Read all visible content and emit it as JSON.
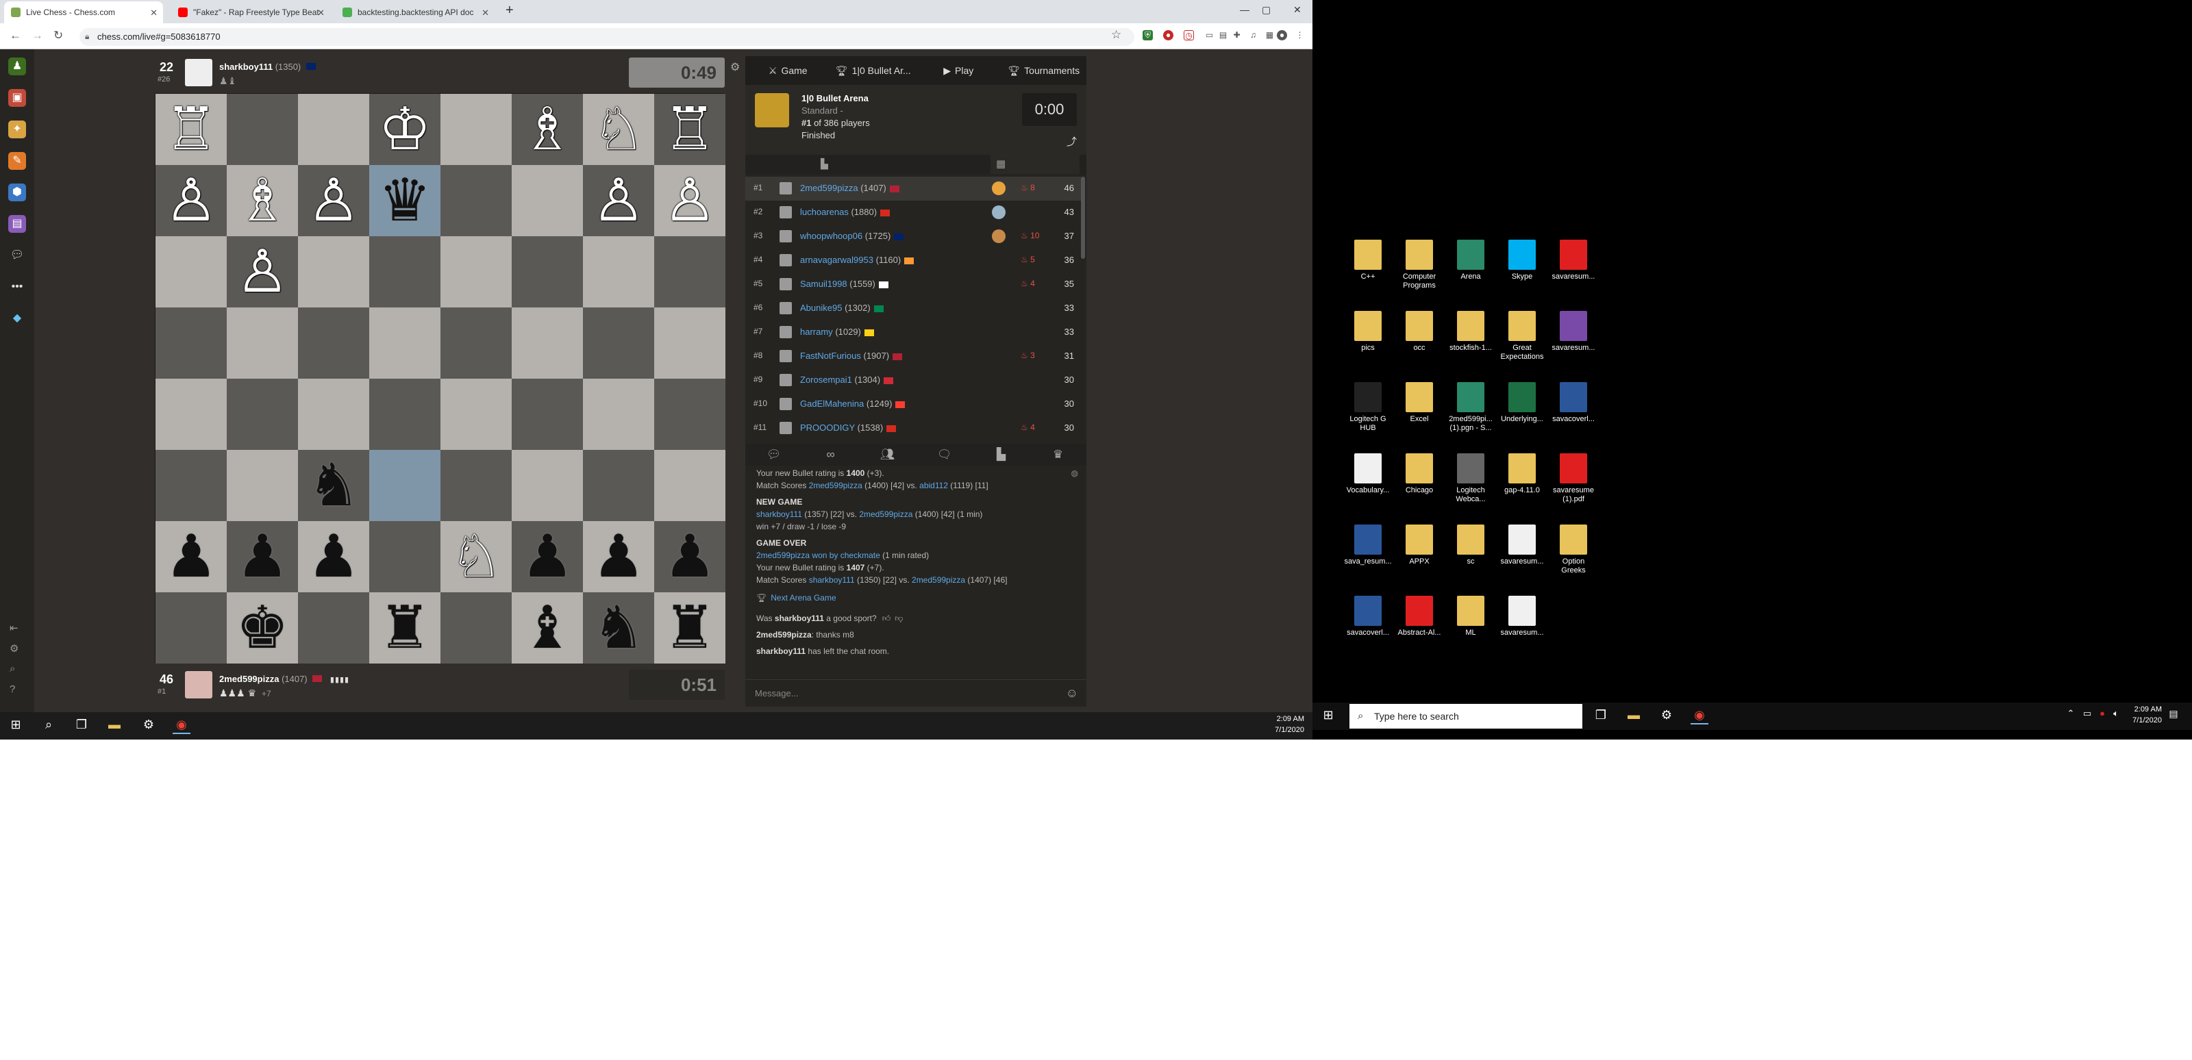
{
  "browser": {
    "tabs": [
      {
        "title": "Live Chess - Chess.com",
        "active": true,
        "fav_color": "#7fa650"
      },
      {
        "title": "\"Fakez\" - Rap Freestyle Type Beat",
        "active": false,
        "fav_color": "#ff0000"
      },
      {
        "title": "backtesting.backtesting API doc",
        "active": false,
        "fav_color": "#4caf50"
      }
    ],
    "new_tab": "+",
    "window_controls": {
      "minimize": "—",
      "maximize": "▢",
      "close": "✕"
    },
    "url": "chess.com/live#g=5083618770"
  },
  "top_player": {
    "score": "22",
    "rank": "#26",
    "name": "sharkboy111",
    "rating": "(1350)",
    "clock": "0:49",
    "captured": "♟♝"
  },
  "bottom_player": {
    "score": "46",
    "rank": "#1",
    "name": "2med599pizza",
    "rating": "(1407)",
    "clock": "0:51",
    "captured": "♟♟♟ ♛",
    "material": "+7"
  },
  "board": [
    [
      "♖",
      "",
      "",
      "♔",
      "",
      "♗",
      "♘",
      "♖"
    ],
    [
      "♙",
      "♗",
      "♙",
      "♛",
      "",
      "",
      "♙",
      "♙"
    ],
    [
      "",
      "♙",
      "",
      "",
      "",
      "",
      "",
      ""
    ],
    [
      "",
      "",
      "",
      "",
      "",
      "",
      "",
      ""
    ],
    [
      "",
      "",
      "",
      "",
      "",
      "",
      "",
      ""
    ],
    [
      "",
      "",
      "♞",
      "",
      "",
      "",
      "",
      ""
    ],
    [
      "♟",
      "♟",
      "♟",
      "",
      "♘",
      "♟",
      "♟",
      "♟"
    ],
    [
      "",
      "♚",
      "",
      "♜",
      "",
      "♝",
      "♞",
      "♜"
    ]
  ],
  "board_colors": {
    "white_pieces": [
      "♔",
      "♕",
      "♖",
      "♗",
      "♘",
      "♙"
    ],
    "highlight": [
      [
        1,
        3
      ],
      [
        5,
        3
      ]
    ],
    "light": "#b5b2ad",
    "dark": "#5b5955",
    "highlight_color": "#7e96a8"
  },
  "panel": {
    "tabs": [
      "Game",
      "1|0 Bullet Ar...",
      "Play",
      "Tournaments"
    ],
    "tab_icons": [
      "swords-icon",
      "trophy-icon",
      "play-icon",
      "trophy-icon"
    ],
    "arena": {
      "title": "1|0 Bullet Arena",
      "subtitle": "Standard -",
      "place": "#1",
      "place_suffix": " of 386 players",
      "status": "Finished",
      "clock": "0:00"
    },
    "standings": [
      {
        "pos": "#1",
        "name": "2med599pizza",
        "rating": "(1407)",
        "flag": "#b22234",
        "medal": "#e8a33c",
        "streak": "8",
        "score": "46",
        "selected": true
      },
      {
        "pos": "#2",
        "name": "luchoarenas",
        "rating": "(1880)",
        "flag": "#d52b1e",
        "medal": "#9ab4c8",
        "streak": "",
        "score": "43"
      },
      {
        "pos": "#3",
        "name": "whoopwhoop06",
        "rating": "(1725)",
        "flag": "#012169",
        "medal": "#c88a4a",
        "streak": "10",
        "score": "37"
      },
      {
        "pos": "#4",
        "name": "arnavagarwal9953",
        "rating": "(1160)",
        "flag": "#ff9933",
        "medal": "",
        "streak": "5",
        "score": "36"
      },
      {
        "pos": "#5",
        "name": "Samuil1998",
        "rating": "(1559)",
        "flag": "#ffffff",
        "medal": "",
        "streak": "4",
        "score": "35"
      },
      {
        "pos": "#6",
        "name": "Abunike95",
        "rating": "(1302)",
        "flag": "#008751",
        "medal": "",
        "streak": "",
        "score": "33"
      },
      {
        "pos": "#7",
        "name": "harramy",
        "rating": "(1029)",
        "flag": "#fcd116",
        "medal": "",
        "streak": "",
        "score": "33"
      },
      {
        "pos": "#8",
        "name": "FastNotFurious",
        "rating": "(1907)",
        "flag": "#b22234",
        "medal": "",
        "streak": "3",
        "score": "31"
      },
      {
        "pos": "#9",
        "name": "Zorosempai1",
        "rating": "(1304)",
        "flag": "#ce2b37",
        "medal": "",
        "streak": "",
        "score": "30"
      },
      {
        "pos": "#10",
        "name": "GadElMahenina",
        "rating": "(1249)",
        "flag": "#fc3d32",
        "medal": "",
        "streak": "",
        "score": "30"
      },
      {
        "pos": "#11",
        "name": "PROOODIGY",
        "rating": "(1538)",
        "flag": "#d52b1e",
        "medal": "",
        "streak": "4",
        "score": "30"
      }
    ],
    "chat": {
      "rating_prefix": "Your new Bullet rating is ",
      "rating1": "1400",
      "rating1_delta": " (+3).",
      "match_scores_label": "Match Scores ",
      "ms1_a": "2med599pizza",
      "ms1_mid": " (1400) [42] vs. ",
      "ms1_b": "abid112",
      "ms1_end": " (1119) [11]",
      "new_game": "NEW GAME",
      "ng_a": "sharkboy111",
      "ng_mid": " (1357) [22] vs. ",
      "ng_b": "2med599pizza",
      "ng_end": " (1400) [42] (1 min)",
      "ng_line2": "win +7 / draw -1 / lose -9",
      "game_over": "GAME OVER",
      "go_winner": "2med599pizza",
      "go_text": " won by checkmate",
      "go_end": " (1 min rated)",
      "rating2": "1407",
      "rating2_delta": " (+7).",
      "ms2_a": "sharkboy111",
      "ms2_mid": " (1350) [22] vs. ",
      "ms2_b": "2med599pizza",
      "ms2_end": " (1407) [46]",
      "next_game": "Next Arena Game",
      "sport_q_pre": "Was ",
      "sport_q_name": "sharkboy111",
      "sport_q_post": " a good sport?",
      "msg1_name": "2med599pizza",
      "msg1_text": ": thanks m8",
      "msg2_name": "sharkboy111",
      "msg2_text": " has left the chat room.",
      "placeholder": "Message..."
    }
  },
  "taskbar_left": {
    "time": "2:09 AM",
    "date": "7/1/2020"
  },
  "desktop": {
    "icons": [
      {
        "label": "C++",
        "color": "#e8c25a"
      },
      {
        "label": "Computer\nPrograms",
        "color": "#e8c25a"
      },
      {
        "label": "Arena",
        "color": "#2a8a6a"
      },
      {
        "label": "Skype",
        "color": "#00aff0"
      },
      {
        "label": "savaresum...",
        "color": "#e02020"
      },
      {
        "label": "pics",
        "color": "#e8c25a"
      },
      {
        "label": "occ",
        "color": "#e8c25a"
      },
      {
        "label": "stockfish-1...",
        "color": "#e8c25a"
      },
      {
        "label": "Great\nExpectations",
        "color": "#e8c25a"
      },
      {
        "label": "savaresum...",
        "color": "#7a4aa8"
      },
      {
        "label": "Logitech G\nHUB",
        "color": "#222222"
      },
      {
        "label": "Excel",
        "color": "#e8c25a"
      },
      {
        "label": "2med599pi...\n(1).pgn - S...",
        "color": "#2a8a6a"
      },
      {
        "label": "Underlying...",
        "color": "#1d7044"
      },
      {
        "label": "savacoverl...",
        "color": "#2b579a"
      },
      {
        "label": "Vocabulary...",
        "color": "#f0f0f0"
      },
      {
        "label": "Chicago",
        "color": "#e8c25a"
      },
      {
        "label": "Logitech\nWebca...",
        "color": "#666666"
      },
      {
        "label": "gap-4.11.0",
        "color": "#e8c25a"
      },
      {
        "label": "savaresume\n(1).pdf",
        "color": "#e02020"
      },
      {
        "label": "sava_resum...",
        "color": "#2b579a"
      },
      {
        "label": "APPX",
        "color": "#e8c25a"
      },
      {
        "label": "sc",
        "color": "#e8c25a"
      },
      {
        "label": "savaresum...",
        "color": "#f0f0f0"
      },
      {
        "label": "Option\nGreeks",
        "color": "#e8c25a"
      },
      {
        "label": "savacoverl...",
        "color": "#2b579a"
      },
      {
        "label": "Abstract-Al...",
        "color": "#e02020"
      },
      {
        "label": "ML",
        "color": "#e8c25a"
      },
      {
        "label": "savaresum...",
        "color": "#f0f0f0"
      }
    ],
    "icon_glyphs": {
      "Skype": "S",
      "PDF": "PDF",
      "Word": "W",
      "Excel": "X",
      "TeX": "TEX"
    },
    "search_placeholder": "Type here to search",
    "time": "2:09 AM",
    "date": "7/1/2020"
  }
}
